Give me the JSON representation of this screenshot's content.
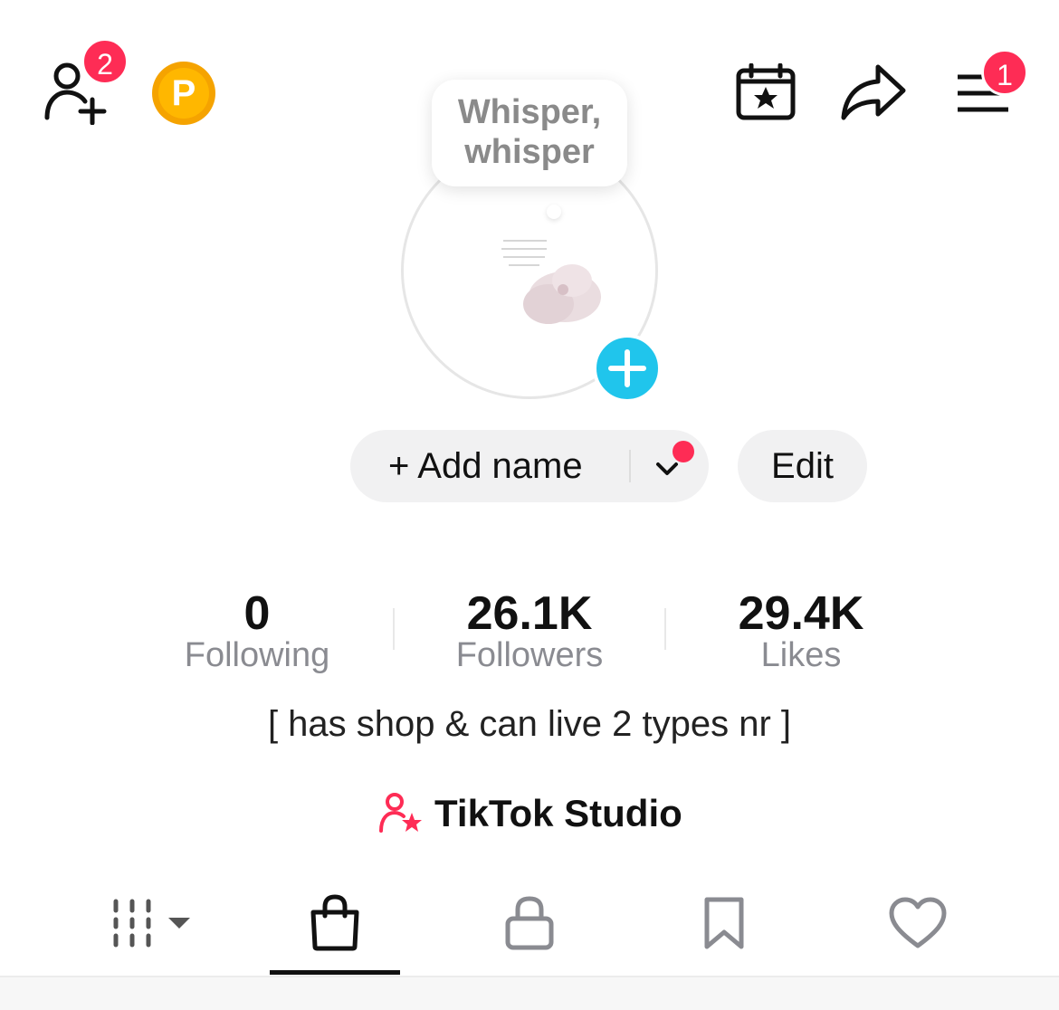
{
  "header": {
    "add_friends_badge": "2",
    "coin_letter": "P",
    "menu_badge": "1"
  },
  "note_bubble": {
    "line1": "Whisper,",
    "line2": "whisper"
  },
  "profile": {
    "add_name_label": "+ Add name",
    "edit_label": "Edit"
  },
  "stats": [
    {
      "value": "0",
      "label": "Following"
    },
    {
      "value": "26.1K",
      "label": "Followers"
    },
    {
      "value": "29.4K",
      "label": "Likes"
    }
  ],
  "bio": "[ has shop & can live 2 types nr ]",
  "studio": {
    "label": "TikTok Studio"
  },
  "tabs": [
    {
      "icon": "videos-grid-icon"
    },
    {
      "icon": "shopping-bag-icon",
      "selected": true
    },
    {
      "icon": "lock-icon"
    },
    {
      "icon": "bookmark-icon"
    },
    {
      "icon": "heart-icon"
    }
  ],
  "colors": {
    "accent_red": "#fe2c55",
    "plus_blue": "#20c5ec",
    "coin_orange": "#f5a300"
  }
}
